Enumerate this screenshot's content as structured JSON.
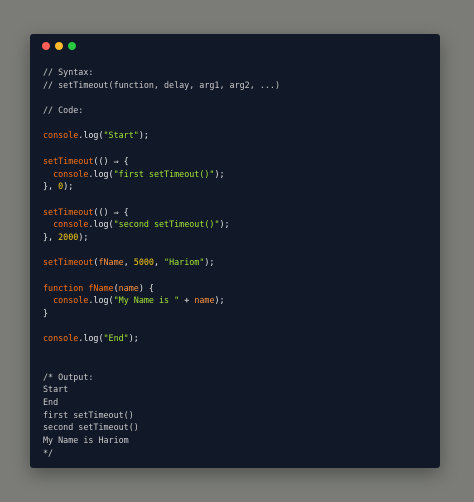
{
  "window": {
    "dot_colors": [
      "#ff5f56",
      "#ffbd2e",
      "#27c93f"
    ]
  },
  "colors": {
    "default": "#e6e6e6",
    "comment": "#c9c9c9",
    "keyword": "#f97316",
    "function": "#f97316",
    "string": "#a3e635",
    "number": "#facc15",
    "param": "#fb923c"
  },
  "code_lines": [
    [
      {
        "t": "// Syntax:",
        "c": "comment"
      }
    ],
    [
      {
        "t": "// setTimeout(function, delay, arg1, arg2, ...)",
        "c": "comment"
      }
    ],
    [],
    [
      {
        "t": "// Code:",
        "c": "comment"
      }
    ],
    [],
    [
      {
        "t": "console",
        "c": "keyword"
      },
      {
        "t": ".log(",
        "c": "default"
      },
      {
        "t": "\"Start\"",
        "c": "string"
      },
      {
        "t": ");",
        "c": "default"
      }
    ],
    [],
    [
      {
        "t": "setTimeout",
        "c": "function"
      },
      {
        "t": "(() ⇒ {",
        "c": "default"
      }
    ],
    [
      {
        "t": "  ",
        "c": "default"
      },
      {
        "t": "console",
        "c": "keyword"
      },
      {
        "t": ".log(",
        "c": "default"
      },
      {
        "t": "\"first setTimeout()\"",
        "c": "string"
      },
      {
        "t": ");",
        "c": "default"
      }
    ],
    [
      {
        "t": "}, ",
        "c": "default"
      },
      {
        "t": "0",
        "c": "number"
      },
      {
        "t": ");",
        "c": "default"
      }
    ],
    [],
    [
      {
        "t": "setTimeout",
        "c": "function"
      },
      {
        "t": "(() ⇒ {",
        "c": "default"
      }
    ],
    [
      {
        "t": "  ",
        "c": "default"
      },
      {
        "t": "console",
        "c": "keyword"
      },
      {
        "t": ".log(",
        "c": "default"
      },
      {
        "t": "\"second setTimeout()\"",
        "c": "string"
      },
      {
        "t": ");",
        "c": "default"
      }
    ],
    [
      {
        "t": "}, ",
        "c": "default"
      },
      {
        "t": "2000",
        "c": "number"
      },
      {
        "t": ");",
        "c": "default"
      }
    ],
    [],
    [
      {
        "t": "setTimeout",
        "c": "function"
      },
      {
        "t": "(",
        "c": "default"
      },
      {
        "t": "fName",
        "c": "param"
      },
      {
        "t": ", ",
        "c": "default"
      },
      {
        "t": "5000",
        "c": "number"
      },
      {
        "t": ", ",
        "c": "default"
      },
      {
        "t": "\"Hariom\"",
        "c": "string"
      },
      {
        "t": ");",
        "c": "default"
      }
    ],
    [],
    [
      {
        "t": "function ",
        "c": "keyword"
      },
      {
        "t": "fName",
        "c": "function"
      },
      {
        "t": "(",
        "c": "default"
      },
      {
        "t": "name",
        "c": "param"
      },
      {
        "t": ") {",
        "c": "default"
      }
    ],
    [
      {
        "t": "  ",
        "c": "default"
      },
      {
        "t": "console",
        "c": "keyword"
      },
      {
        "t": ".log(",
        "c": "default"
      },
      {
        "t": "\"My Name is \"",
        "c": "string"
      },
      {
        "t": " + ",
        "c": "default"
      },
      {
        "t": "name",
        "c": "param"
      },
      {
        "t": ");",
        "c": "default"
      }
    ],
    [
      {
        "t": "}",
        "c": "default"
      }
    ],
    [],
    [
      {
        "t": "console",
        "c": "keyword"
      },
      {
        "t": ".log(",
        "c": "default"
      },
      {
        "t": "\"End\"",
        "c": "string"
      },
      {
        "t": ");",
        "c": "default"
      }
    ],
    [],
    [],
    [
      {
        "t": "/* Output:",
        "c": "comment"
      }
    ],
    [
      {
        "t": "Start",
        "c": "comment"
      }
    ],
    [
      {
        "t": "End",
        "c": "comment"
      }
    ],
    [
      {
        "t": "first setTimeout()",
        "c": "comment"
      }
    ],
    [
      {
        "t": "second setTimeout()",
        "c": "comment"
      }
    ],
    [
      {
        "t": "My Name is Hariom",
        "c": "comment"
      }
    ],
    [
      {
        "t": "*/",
        "c": "comment"
      }
    ]
  ]
}
